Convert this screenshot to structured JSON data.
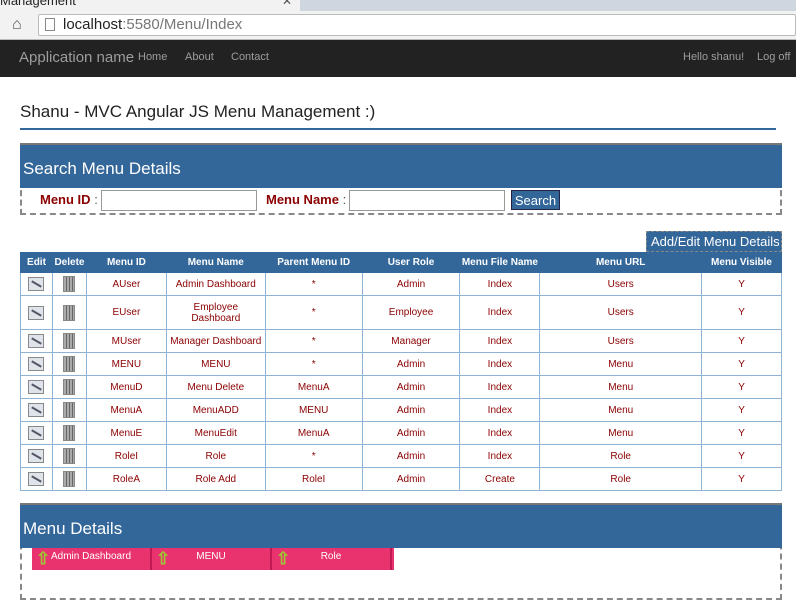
{
  "browser": {
    "tab_title": "Management",
    "url_host": "localhost",
    "url_rest": ":5580/Menu/Index"
  },
  "navbar": {
    "brand": "Application name",
    "links": [
      "Home",
      "About",
      "Contact"
    ],
    "greeting": "Hello shanu!",
    "logoff": "Log off"
  },
  "page_title": "Shanu - MVC Angular JS Menu Management :)",
  "search": {
    "title": "Search Menu Details",
    "menu_id_label": "Menu ID",
    "menu_name_label": "Menu Name",
    "sep": ":",
    "menu_id_value": "",
    "menu_name_value": "",
    "button": "Search"
  },
  "add_edit_button": "Add/Edit Menu Details",
  "table": {
    "headers": [
      "Edit",
      "Delete",
      "Menu ID",
      "Menu Name",
      "Parent Menu ID",
      "User Role",
      "Menu File Name",
      "Menu URL",
      "Menu Visible"
    ],
    "rows": [
      [
        "AUser",
        "Admin Dashboard",
        "*",
        "Admin",
        "Index",
        "Users",
        "Y"
      ],
      [
        "EUser",
        "Employee Dashboard",
        "*",
        "Employee",
        "Index",
        "Users",
        "Y"
      ],
      [
        "MUser",
        "Manager Dashboard",
        "*",
        "Manager",
        "Index",
        "Users",
        "Y"
      ],
      [
        "MENU",
        "MENU",
        "*",
        "Admin",
        "Index",
        "Menu",
        "Y"
      ],
      [
        "MenuD",
        "Menu Delete",
        "MenuA",
        "Admin",
        "Index",
        "Menu",
        "Y"
      ],
      [
        "MenuA",
        "MenuADD",
        "MENU",
        "Admin",
        "Index",
        "Menu",
        "Y"
      ],
      [
        "MenuE",
        "MenuEdit",
        "MenuA",
        "Admin",
        "Index",
        "Menu",
        "Y"
      ],
      [
        "RoleI",
        "Role",
        "*",
        "Admin",
        "Index",
        "Role",
        "Y"
      ],
      [
        "RoleA",
        "Role Add",
        "RoleI",
        "Admin",
        "Create",
        "Role",
        "Y"
      ]
    ]
  },
  "details": {
    "title": "Menu Details",
    "menu_items": [
      "Admin Dashboard",
      "MENU",
      "Role"
    ]
  }
}
